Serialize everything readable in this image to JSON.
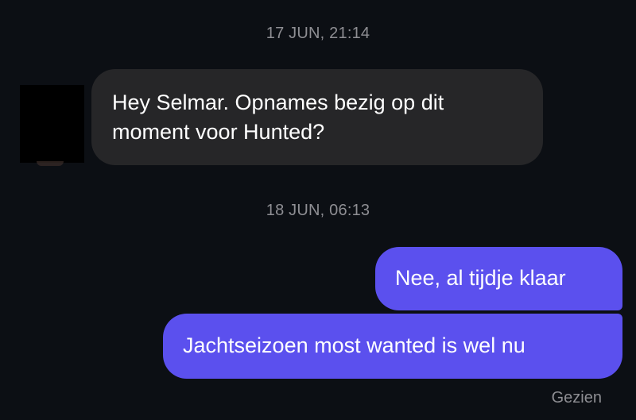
{
  "conversation": {
    "messages": [
      {
        "timestamp": "17 JUN, 21:14",
        "direction": "incoming",
        "text": "Hey Selmar. Opnames bezig op dit moment voor Hunted?"
      },
      {
        "timestamp": "18 JUN, 06:13",
        "direction": "outgoing",
        "text": "Nee, al tijdje klaar"
      },
      {
        "direction": "outgoing",
        "text": "Jachtseizoen most wanted is wel nu"
      }
    ],
    "read_receipt": "Gezien"
  },
  "colors": {
    "background": "#0c0f14",
    "incoming_bubble": "#262628",
    "outgoing_bubble": "#5b50ee",
    "timestamp_text": "#8e8e93"
  }
}
